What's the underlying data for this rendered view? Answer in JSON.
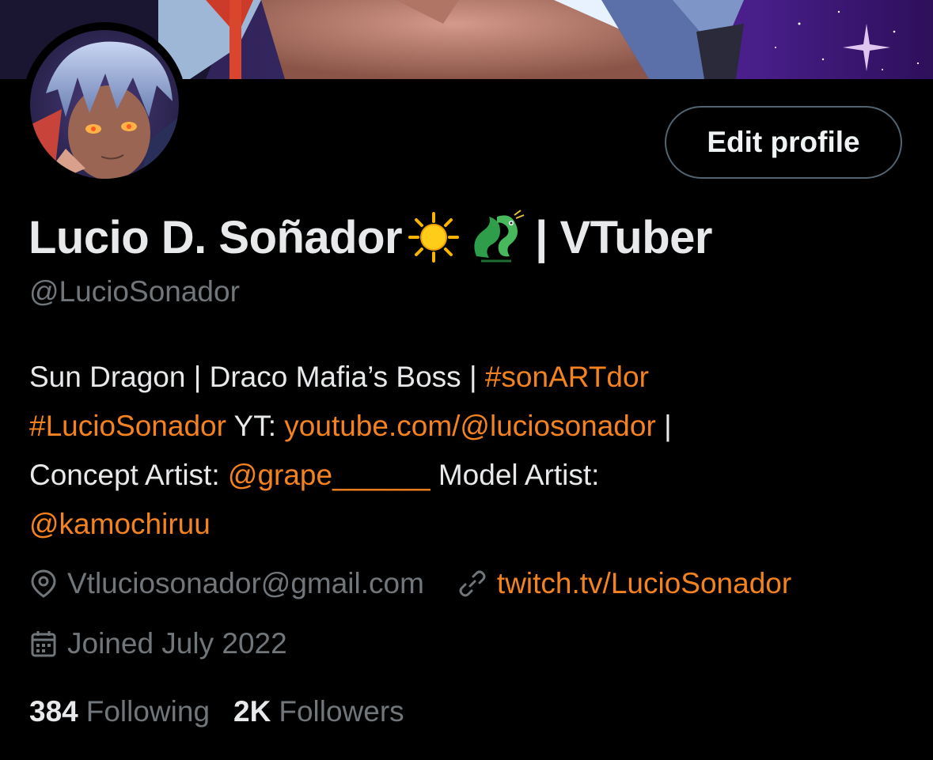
{
  "profile": {
    "display_name": "Lucio D. Soñador",
    "name_suffix": "| VTuber",
    "name_emojis": [
      "sun-emoji",
      "dragon-emoji"
    ],
    "handle": "@LucioSonador",
    "edit_button_label": "Edit profile"
  },
  "bio": {
    "line1_text": "Sun Dragon | Draco Mafia’s Boss |",
    "hashtag1": "#sonARTdor",
    "hashtag2": "#LucioSonador",
    "yt_label": "YT:",
    "yt_link": "youtube.com/@luciosonador",
    "separator": "|",
    "concept_label": "Concept Artist:",
    "concept_mention": "@grape______",
    "model_label": "Model Artist:",
    "model_mention": "@kamochiruu"
  },
  "meta": {
    "location_icon": "location-pin-icon",
    "location": "Vtluciosonador@gmail.com",
    "link_icon": "link-icon",
    "website": "twitch.tv/LucioSonador",
    "calendar_icon": "calendar-icon",
    "joined": "Joined July 2022"
  },
  "stats": {
    "following_count": "384",
    "following_label": "Following",
    "followers_count": "2K",
    "followers_label": "Followers"
  },
  "colors": {
    "background": "#000000",
    "text_primary": "#e7e9ea",
    "text_secondary": "#71767b",
    "accent": "#f4821f",
    "button_border": "#536471"
  }
}
